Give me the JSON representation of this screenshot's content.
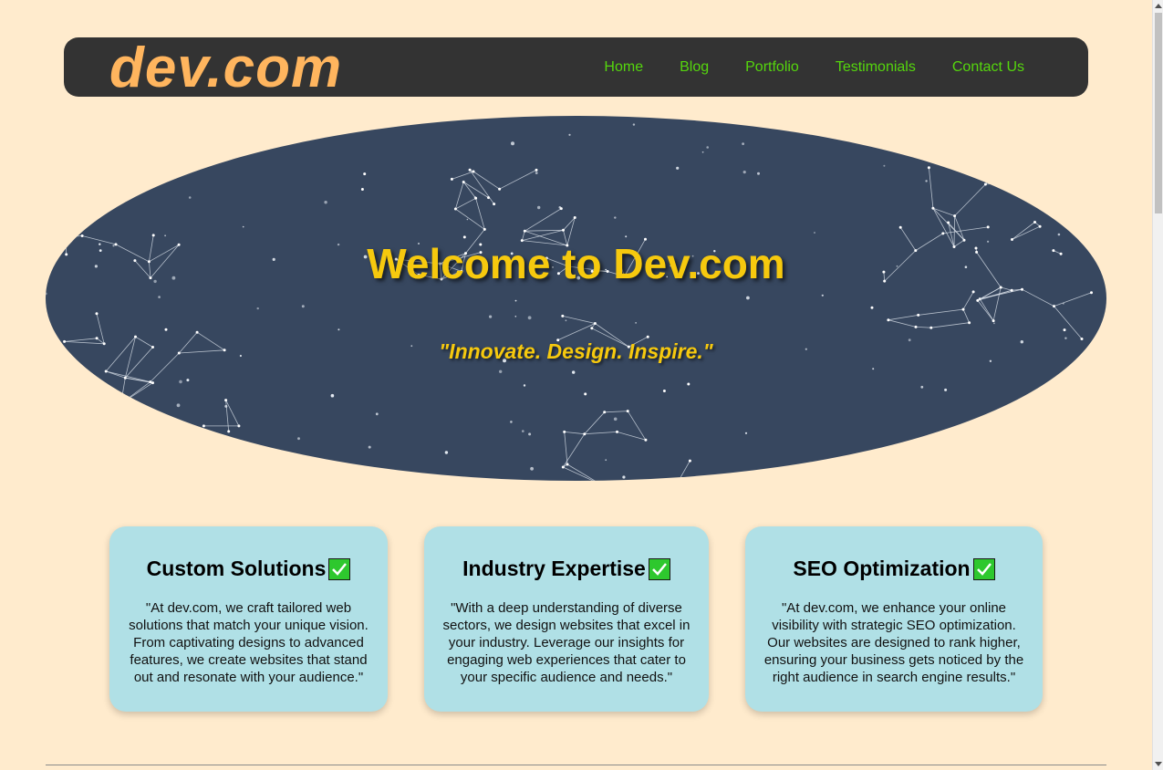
{
  "header": {
    "logo": "dev.com",
    "nav": [
      "Home",
      "Blog",
      "Portfolio",
      "Testimonials",
      "Contact Us"
    ]
  },
  "hero": {
    "title": "Welcome to Dev.com",
    "tagline": "\"Innovate. Design. Inspire.\""
  },
  "cards": [
    {
      "title": "Custom Solutions",
      "text": "\"At dev.com, we craft tailored web solutions that match your unique vision. From captivating designs to advanced features, we create websites that stand out and resonate with your audience.\""
    },
    {
      "title": "Industry Expertise",
      "text": "\"With a deep understanding of diverse sectors, we design websites that excel in your industry. Leverage our insights for engaging web experiences that cater to your specific audience and needs.\""
    },
    {
      "title": "SEO Optimization",
      "text": "\"At dev.com, we enhance your online visibility with strategic SEO optimization. Our websites are designed to rank higher, ensuring your business gets noticed by the right audience in search engine results.\""
    }
  ],
  "colors": {
    "background": "#ffebcd",
    "header": "#333333",
    "logo": "#ffb55e",
    "nav_link": "#55d60d",
    "hero_bg": "#37475f",
    "hero_text": "#f6c90e",
    "card_bg": "#b0e0e6",
    "check": "#2ec82e"
  },
  "icons": {
    "card_badge": "check-mark-icon"
  }
}
